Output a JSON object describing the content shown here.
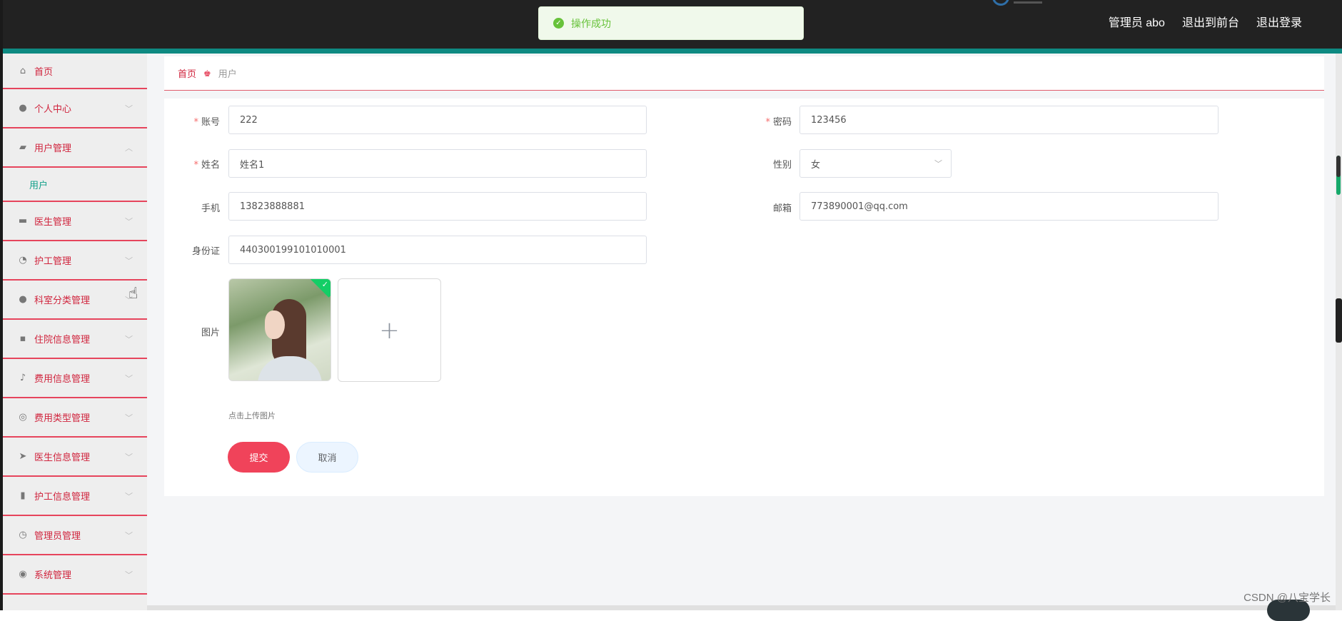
{
  "header": {
    "admin_label": "管理员 abo",
    "to_front": "退出到前台",
    "logout": "退出登录"
  },
  "toast": {
    "text": "操作成功"
  },
  "breadcrumb": {
    "home": "首页",
    "current": "用户"
  },
  "sidebar": {
    "items": [
      {
        "label": "首页",
        "icon": "home-icon"
      },
      {
        "label": "个人中心",
        "icon": "user-icon"
      },
      {
        "label": "用户管理",
        "icon": "ticket-icon"
      },
      {
        "label": "用户",
        "icon": ""
      },
      {
        "label": "医生管理",
        "icon": "monitor-icon"
      },
      {
        "label": "护工管理",
        "icon": "gauge-icon"
      },
      {
        "label": "科室分类管理",
        "icon": "user-icon"
      },
      {
        "label": "住院信息管理",
        "icon": "message-icon"
      },
      {
        "label": "费用信息管理",
        "icon": "mic-icon"
      },
      {
        "label": "费用类型管理",
        "icon": "target-icon"
      },
      {
        "label": "医生信息管理",
        "icon": "send-icon"
      },
      {
        "label": "护工信息管理",
        "icon": "bar-chart-icon"
      },
      {
        "label": "管理员管理",
        "icon": "clock-icon"
      },
      {
        "label": "系统管理",
        "icon": "settings-icon"
      }
    ]
  },
  "form": {
    "account_label": "账号",
    "account_value": "222",
    "password_label": "密码",
    "password_value": "123456",
    "name_label": "姓名",
    "name_value": "姓名1",
    "gender_label": "性别",
    "gender_value": "女",
    "phone_label": "手机",
    "phone_value": "13823888881",
    "email_label": "邮箱",
    "email_value": "773890001@qq.com",
    "idcard_label": "身份证",
    "idcard_value": "440300199101010001",
    "image_label": "图片",
    "upload_tip": "点击上传图片",
    "submit": "提交",
    "cancel": "取消"
  },
  "watermark": "CSDN @八宝学长"
}
